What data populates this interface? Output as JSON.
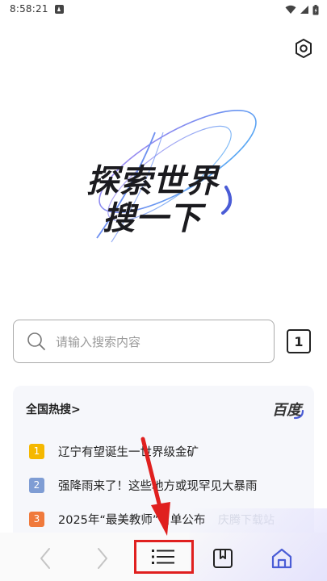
{
  "status_bar": {
    "time": "8:58:21",
    "icons": [
      "notification-icon",
      "wifi-icon",
      "signal-icon",
      "battery-icon"
    ]
  },
  "hero": {
    "line1": "探索世界",
    "line2": "搜一下"
  },
  "search": {
    "placeholder": "请输入搜索内容"
  },
  "tabs": {
    "count": "1"
  },
  "hot_search": {
    "title": "全国热搜>",
    "brand": "百度",
    "items": [
      {
        "rank": "1",
        "text": "辽宁有望诞生一世界级金矿",
        "color": "#f5b800"
      },
      {
        "rank": "2",
        "text": "强降雨来了！这些地方或现罕见大暴雨",
        "color": "#7f9dd4"
      },
      {
        "rank": "3",
        "text": "2025年“最美教师”名单公布",
        "color": "#f07a3c"
      }
    ]
  },
  "watermark": "庆腾下载站",
  "bottom_nav": {
    "icons": [
      "back-icon",
      "forward-icon",
      "menu-icon",
      "bookmark-icon",
      "home-icon"
    ]
  },
  "colors": {
    "highlight": "#e0201f",
    "accent": "#4a5cd6"
  }
}
